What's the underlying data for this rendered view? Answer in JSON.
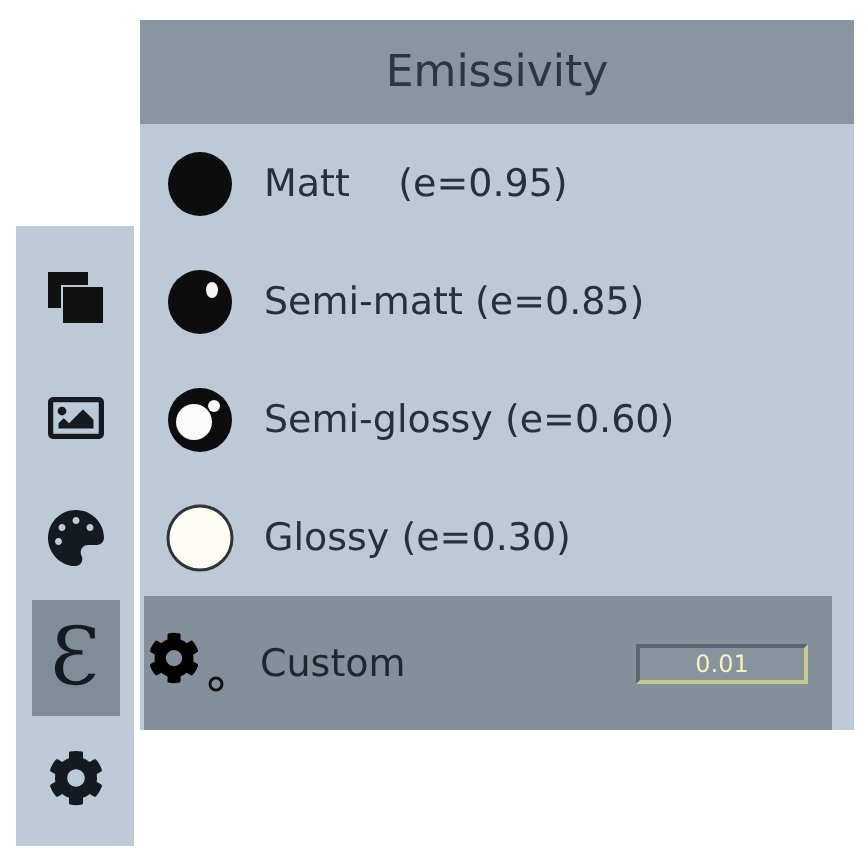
{
  "sidebar": {
    "tabs": [
      {
        "kind": "layers",
        "selected": false
      },
      {
        "kind": "image",
        "selected": false
      },
      {
        "kind": "palette",
        "selected": false
      },
      {
        "kind": "glyph",
        "glyph": "Ɛ",
        "selected": true
      },
      {
        "kind": "gear",
        "selected": false
      }
    ]
  },
  "panel": {
    "title": "Emissivity",
    "options": [
      {
        "kind": "matt",
        "label": "Matt    (e=0.95)",
        "selected": false
      },
      {
        "kind": "semi-matt",
        "label": "Semi-matt (e=0.85)",
        "selected": false
      },
      {
        "kind": "semi-glossy",
        "label": "Semi-glossy (e=0.60)",
        "selected": false
      },
      {
        "kind": "glossy",
        "label": "Glossy (e=0.30)",
        "selected": false
      },
      {
        "kind": "custom",
        "label": "Custom",
        "value": "0.01",
        "selected": true
      }
    ]
  }
}
